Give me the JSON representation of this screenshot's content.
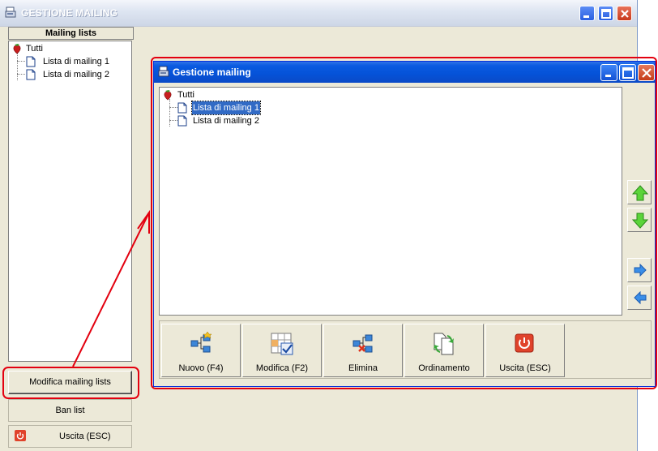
{
  "main_window": {
    "title": "GESTIONE MAILING",
    "left_panel": {
      "header": "Mailing lists",
      "tree": {
        "root": "Tutti",
        "children": [
          "Lista di mailing 1",
          "Lista di mailing 2"
        ]
      }
    },
    "buttons": {
      "modifica": "Modifica mailing lists",
      "ban": "Ban list",
      "uscita": "Uscita (ESC)"
    }
  },
  "dialog": {
    "title": "Gestione mailing",
    "tree": {
      "root": "Tutti",
      "children": [
        "Lista di mailing 1",
        "Lista di mailing 2"
      ],
      "selected_index": 0
    },
    "toolbar": [
      {
        "label": "Nuovo (F4)",
        "icon": "new-node-icon"
      },
      {
        "label": "Modifica (F2)",
        "icon": "edit-grid-icon"
      },
      {
        "label": "Elimina",
        "icon": "delete-node-icon"
      },
      {
        "label": "Ordinamento",
        "icon": "sort-pages-icon"
      },
      {
        "label": "Uscita (ESC)",
        "icon": "power-icon"
      }
    ]
  },
  "colors": {
    "callout": "#e3000f",
    "xp_blue": "#0a5ae0",
    "face": "#ece9d8"
  }
}
